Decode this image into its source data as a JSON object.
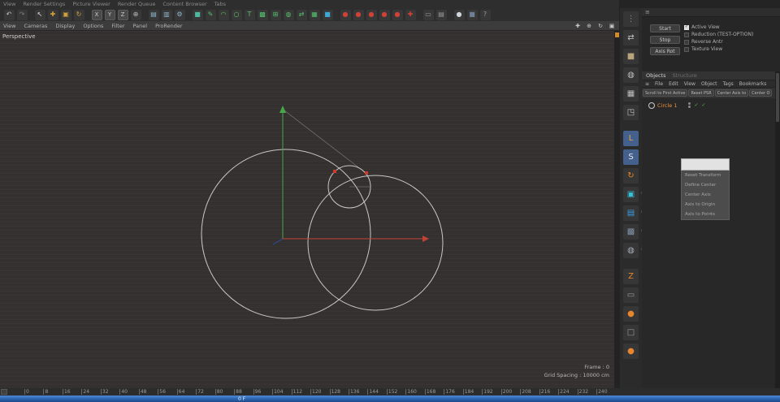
{
  "menubar": {
    "items": [
      "View",
      "Render Settings",
      "Picture Viewer",
      "Render Queue",
      "Content Browser",
      "Tabs"
    ]
  },
  "toolbar": {
    "icons": [
      {
        "name": "undo-icon",
        "glyph": "↶",
        "color": "#c4c4c4"
      },
      {
        "name": "redo-icon",
        "glyph": "↷",
        "color": "#7e7e7e"
      },
      {
        "sep": true
      },
      {
        "name": "live-selection-icon",
        "glyph": "↖",
        "color": "#e0e0e0"
      },
      {
        "name": "move-tool-icon",
        "glyph": "✚",
        "color": "#d3a43c"
      },
      {
        "name": "scale-tool-icon",
        "glyph": "▣",
        "color": "#d3a43c"
      },
      {
        "name": "rotate-tool-icon",
        "glyph": "↻",
        "color": "#d3a43c"
      },
      {
        "sep": true
      },
      {
        "name": "lock-x-button",
        "glyph": "X",
        "cls": "letterbox"
      },
      {
        "name": "lock-y-button",
        "glyph": "Y",
        "cls": "letterbox"
      },
      {
        "name": "lock-z-button",
        "glyph": "Z",
        "cls": "letterbox"
      },
      {
        "name": "coordinate-system-icon",
        "glyph": "⊕",
        "color": "#bdbdbd"
      },
      {
        "sep": true
      },
      {
        "name": "render-view-icon",
        "glyph": "▤",
        "color": "#8fb6c9"
      },
      {
        "name": "render-picture-viewer-icon",
        "glyph": "▥",
        "color": "#8fb6c9"
      },
      {
        "name": "render-settings-icon",
        "glyph": "⚙",
        "color": "#8fb6c9"
      },
      {
        "sep": true
      },
      {
        "name": "cube-primitive-icon",
        "glyph": "■",
        "color": "#4fb79e"
      },
      {
        "name": "spline-pen-icon",
        "glyph": "✎",
        "color": "#57c06c"
      },
      {
        "name": "spline-arc-icon",
        "glyph": "◠",
        "color": "#57c06c"
      },
      {
        "name": "spline-circle-icon",
        "glyph": "○",
        "color": "#57c06c"
      },
      {
        "name": "spline-text-icon",
        "glyph": "T",
        "color": "#57c06c"
      },
      {
        "name": "subdivision-surface-icon",
        "glyph": "▩",
        "color": "#57c06c"
      },
      {
        "name": "array-generator-icon",
        "glyph": "⊞",
        "color": "#57c06c"
      },
      {
        "name": "boole-generator-icon",
        "glyph": "◍",
        "color": "#57c06c"
      },
      {
        "name": "symmetry-generator-icon",
        "glyph": "⇄",
        "color": "#57c06c"
      },
      {
        "name": "instance-generator-icon",
        "glyph": "▦",
        "color": "#57c06c"
      },
      {
        "name": "workplane-icon",
        "glyph": "■",
        "color": "#3fa7d6"
      },
      {
        "sep": true
      },
      {
        "name": "floor-object-icon",
        "glyph": "●",
        "color": "#d24234"
      },
      {
        "name": "sky-object-icon",
        "glyph": "●",
        "color": "#d24234"
      },
      {
        "name": "environment-object-icon",
        "glyph": "●",
        "color": "#d24234"
      },
      {
        "name": "light-object-icon",
        "glyph": "●",
        "color": "#d24234"
      },
      {
        "name": "camera-object-icon",
        "glyph": "●",
        "color": "#d24234"
      },
      {
        "name": "stage-object-icon",
        "glyph": "✚",
        "color": "#d24234"
      },
      {
        "sep": true
      },
      {
        "name": "keyframe-icon",
        "glyph": "▭",
        "color": "#9a9a9a"
      },
      {
        "name": "record-icon",
        "glyph": "▤",
        "color": "#9a9a9a"
      },
      {
        "sep": true
      },
      {
        "name": "sphere-shade-icon",
        "glyph": "●",
        "color": "#cfd6de"
      },
      {
        "name": "cube-shade-icon",
        "glyph": "■",
        "color": "#6f8096"
      },
      {
        "name": "help-icon",
        "glyph": "?",
        "color": "#9a9a9a"
      }
    ]
  },
  "viewport_menu": {
    "items": [
      "View",
      "Cameras",
      "Display",
      "Options",
      "Filter",
      "Panel",
      "ProRender"
    ],
    "controls": [
      {
        "name": "pan-view-icon",
        "glyph": "✚",
        "color": "#c8c8c8"
      },
      {
        "name": "zoom-view-icon",
        "glyph": "⊕",
        "color": "#c8c8c8"
      },
      {
        "name": "rotate-view-icon",
        "glyph": "↻",
        "color": "#c8c8c8"
      },
      {
        "name": "maximize-view-icon",
        "glyph": "▣",
        "color": "#c8c8c8"
      }
    ]
  },
  "viewport": {
    "camera_label": "Perspective",
    "frame_label": "Frame : 0",
    "grid_label": "Grid Spacing : 10000 cm"
  },
  "side_toolbar": {
    "icons": [
      {
        "name": "grip-icon",
        "glyph": "⋮",
        "color": "#8a8a8a"
      },
      {
        "name": "make-editable-icon",
        "glyph": "⇄",
        "color": "#c0c0c0"
      },
      {
        "name": "model-mode-icon",
        "glyph": "■",
        "color": "#b9a37a"
      },
      {
        "name": "texture-mode-icon",
        "glyph": "◍",
        "color": "#c0c0c0"
      },
      {
        "name": "workplane-mode-icon",
        "glyph": "▦",
        "color": "#c0c0c0"
      },
      {
        "name": "object-axis-mode-icon",
        "glyph": "◳",
        "color": "#c0c0c0"
      },
      {
        "sep": true
      },
      {
        "name": "enable-axis-icon",
        "glyph": "L",
        "color": "#e8a33a",
        "hl": true
      },
      {
        "name": "solo-mode-icon",
        "glyph": "S",
        "color": "#e6e6e6",
        "hl": true
      },
      {
        "name": "rotate-swirl-icon",
        "glyph": "↻",
        "color": "#e8862d"
      },
      {
        "name": "points-mode-icon",
        "glyph": "▣",
        "color": "#39c2d7",
        "gear": true
      },
      {
        "name": "edges-mode-icon",
        "glyph": "▤",
        "color": "#3aa0e8",
        "gear": true
      },
      {
        "name": "polygons-mode-icon",
        "glyph": "▩",
        "color": "#8193a8",
        "gear": true
      },
      {
        "name": "uv-mode-icon",
        "glyph": "◍",
        "color": "#aab2bc",
        "gear": true
      },
      {
        "sep": true
      },
      {
        "name": "history-icon",
        "glyph": "Z",
        "color": "#e8862d"
      },
      {
        "name": "snap-icon",
        "glyph": "▭",
        "color": "#9a9a9a"
      },
      {
        "name": "magnet-dot-icon",
        "glyph": "●",
        "color": "#e8862d"
      },
      {
        "name": "grid-snap-icon",
        "glyph": "□",
        "color": "#9a9a9a"
      },
      {
        "name": "workplane-dot-icon",
        "glyph": "●",
        "color": "#e8862d"
      }
    ]
  },
  "right_panel": {
    "header_icon": "≡",
    "transport": {
      "check_glyph": "✓",
      "buttons": [
        {
          "name": "start-button",
          "label": "Start"
        },
        {
          "name": "stop-button",
          "label": "Stop"
        },
        {
          "name": "axis-rot-button",
          "label": "Axis Rot"
        }
      ],
      "checkboxes": [
        {
          "label": "Active View",
          "checked": true
        },
        {
          "label": "Reduction (TEST-OPTION)",
          "checked": false
        },
        {
          "label": "Reverse Antr",
          "checked": false
        },
        {
          "label": "Texture View",
          "checked": false
        }
      ]
    },
    "objects": {
      "menu_icon": "≡",
      "tabs": [
        {
          "label": "Objects"
        },
        {
          "label": "Structure"
        }
      ],
      "menu": [
        "File",
        "Edit",
        "View",
        "Object",
        "Tags",
        "Bookmarks"
      ],
      "actions": [
        "Scroll to First Active",
        "Reset PSR",
        "Center Axis to",
        "Center O"
      ],
      "items": [
        {
          "name": "Circle 1",
          "enabled_glyph": "✓"
        }
      ]
    }
  },
  "context_menu": {
    "items": [
      "Reset Transform",
      "Define Center",
      "Center Axis",
      "Axis to Origin",
      "Axis to Points"
    ]
  },
  "timeline": {
    "ticks": [
      0,
      8,
      16,
      24,
      32,
      40,
      48,
      56,
      64,
      72,
      80,
      88,
      96,
      104,
      112,
      120,
      128,
      136,
      144,
      152,
      160,
      168,
      176,
      184,
      192,
      200,
      208,
      216,
      224,
      232,
      240
    ],
    "playhead_label": "0 F"
  },
  "colors": {
    "accent_orange": "#e8923a",
    "selection_blue": "#44618e",
    "timeline_blue": "#2c62ad",
    "axis_green": "#47a747",
    "axis_red": "#c04234",
    "axis_blue": "#2b4ea0",
    "spline_stroke": "#c9c9c9",
    "point_red": "#d03a2a"
  }
}
